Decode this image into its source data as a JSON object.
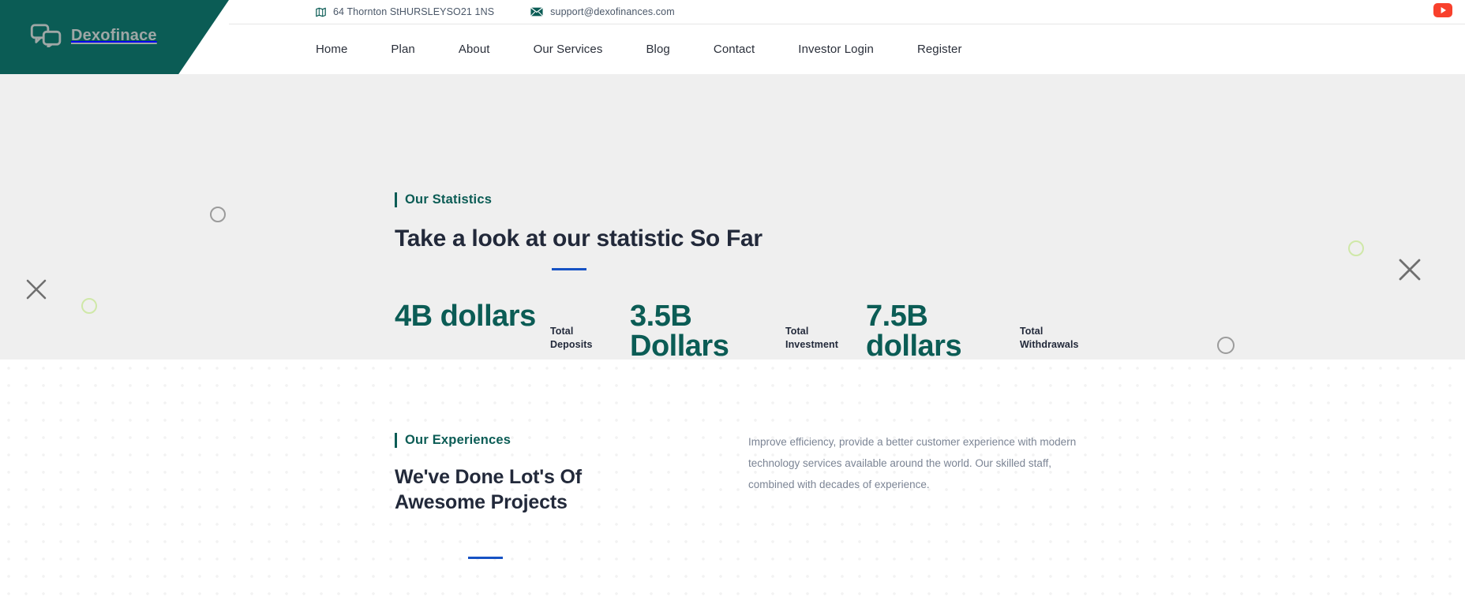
{
  "brand": {
    "name": "Dexofinace",
    "logo_icon": "chat-bubbles-icon",
    "wedge_color": "#0b5c55"
  },
  "topbar": {
    "address_icon": "map-icon",
    "address": "64 Thornton StHURSLEYSO21 1NS",
    "email_icon": "envelope-icon",
    "email": "support@dexofinances.com",
    "social_icon": "youtube-icon"
  },
  "nav": {
    "items": [
      {
        "label": "Home"
      },
      {
        "label": "Plan"
      },
      {
        "label": "About"
      },
      {
        "label": "Our Services"
      },
      {
        "label": "Blog"
      },
      {
        "label": "Contact"
      },
      {
        "label": "Investor Login"
      },
      {
        "label": "Register"
      }
    ]
  },
  "stats_section": {
    "eyebrow": "Our Statistics",
    "title": "Take a look at our statistic So Far",
    "accent_color": "#0b5c55",
    "rule_color": "#1652c4",
    "background": "#efefef",
    "items": [
      {
        "value": "4B dollars",
        "label": "Total Deposits"
      },
      {
        "value": "3.5B Dollars",
        "label": "Total Investment"
      },
      {
        "value": "7.5B dollars",
        "label": "Total Withdrawals"
      }
    ]
  },
  "experiences_section": {
    "eyebrow": "Our Experiences",
    "title": "We've Done Lot's Of Awesome Projects",
    "body": "Improve efficiency, provide a better customer experience with modern technology services available around the world. Our skilled staff, combined with decades of experience."
  },
  "decorations": {
    "circle_gray": "#9b9b9b",
    "circle_green": "#cfe8a8",
    "x_gray": "#6f6f6f"
  }
}
